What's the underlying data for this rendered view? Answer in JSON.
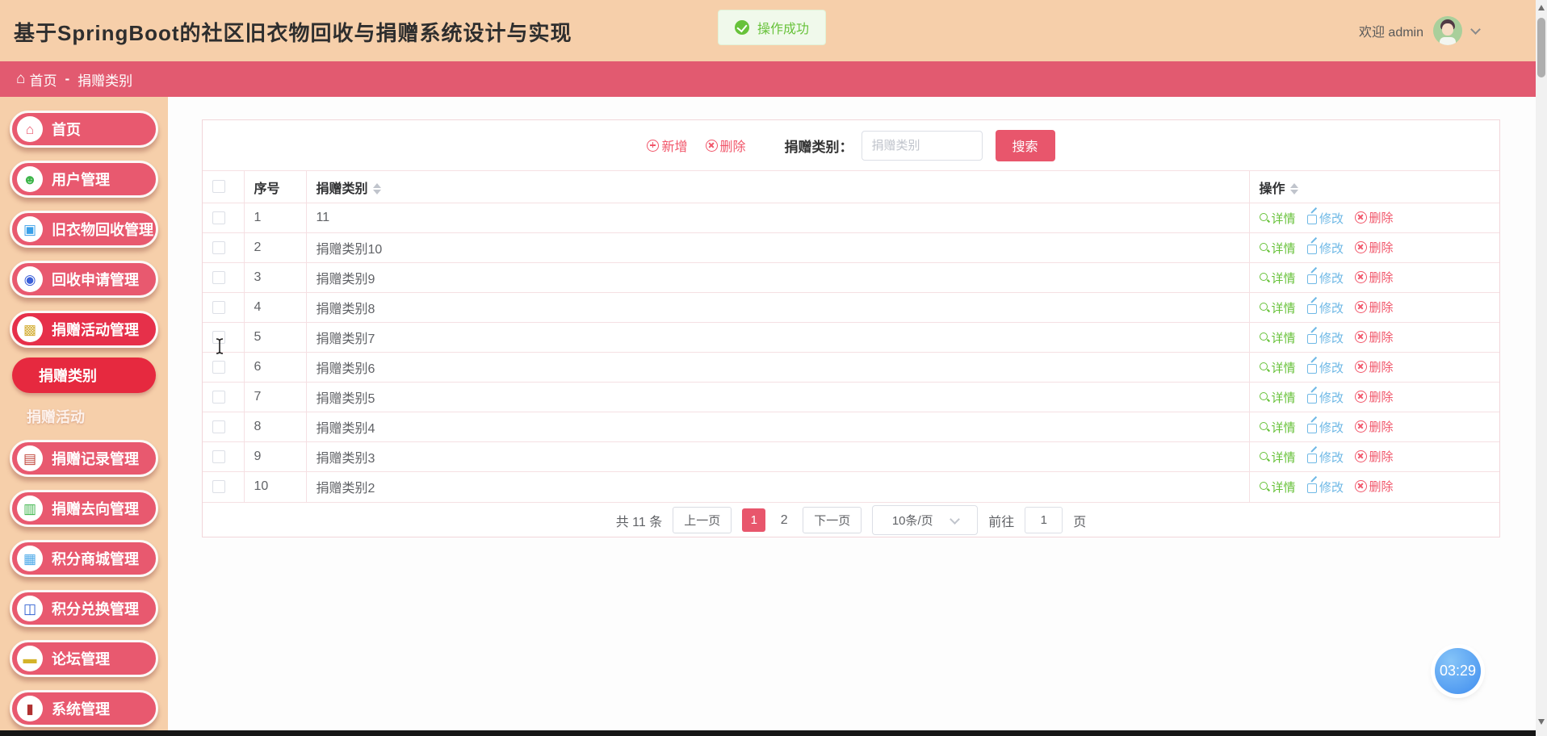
{
  "header": {
    "title": "基于SpringBoot的社区旧衣物回收与捐赠系统设计与实现",
    "toast": "操作成功",
    "welcome": "欢迎 admin"
  },
  "breadcrumb": {
    "home_icon": "⌂",
    "home": "首页",
    "separator": "-",
    "current": "捐赠类别"
  },
  "colors": {
    "peach": "#f6cfaa",
    "breadcrumb_red": "#e25a70",
    "pill_red": "#e8596f",
    "pill_active_red": "#e6304a",
    "accent_red": "#e8566c",
    "success_green": "#67c23a",
    "edit_blue": "#6fb9e6",
    "clock_blue": "#3f8def"
  },
  "sidebar": {
    "items": [
      {
        "label": "首页",
        "icon": "home-icon",
        "glyph": "⌂",
        "icon_color": "#e8566c"
      },
      {
        "label": "用户管理",
        "icon": "user-icon",
        "glyph": "☻",
        "icon_color": "#3cb54a"
      },
      {
        "label": "旧衣物回收管理",
        "icon": "chip-icon",
        "glyph": "▣",
        "icon_color": "#3aa0e8"
      },
      {
        "label": "回收申请管理",
        "icon": "circle-dots-icon",
        "glyph": "◉",
        "icon_color": "#3a5fd8"
      },
      {
        "label": "捐赠活动管理",
        "icon": "donation-box-icon",
        "glyph": "▩",
        "icon_color": "#d4af37"
      },
      {
        "label": "捐赠记录管理",
        "icon": "ledger-icon",
        "glyph": "▤",
        "icon_color": "#c0443a"
      },
      {
        "label": "捐赠去向管理",
        "icon": "book-icon",
        "glyph": "▥",
        "icon_color": "#3cb54a"
      },
      {
        "label": "积分商城管理",
        "icon": "grid-icon",
        "glyph": "▦",
        "icon_color": "#4aa8e8"
      },
      {
        "label": "积分兑换管理",
        "icon": "columns-icon",
        "glyph": "◫",
        "icon_color": "#2f5fd0"
      },
      {
        "label": "论坛管理",
        "icon": "ticket-icon",
        "glyph": "▬",
        "icon_color": "#d4b32a"
      },
      {
        "label": "系统管理",
        "icon": "device-icon",
        "glyph": "▮",
        "icon_color": "#b03030"
      }
    ],
    "submenu": [
      {
        "label": "捐赠类别",
        "active": true
      },
      {
        "label": "捐赠活动",
        "active": false
      }
    ]
  },
  "toolbar": {
    "add_label": "新增",
    "delete_label": "删除",
    "search_label": "捐赠类别：",
    "search_placeholder": "捐赠类别",
    "search_button": "搜索"
  },
  "table": {
    "headers": {
      "index": "序号",
      "category": "捐赠类别",
      "actions": "操作"
    },
    "action_labels": {
      "detail": "详情",
      "edit": "修改",
      "remove": "删除"
    },
    "rows": [
      {
        "no": "1",
        "category": "11"
      },
      {
        "no": "2",
        "category": "捐赠类别10"
      },
      {
        "no": "3",
        "category": "捐赠类别9"
      },
      {
        "no": "4",
        "category": "捐赠类别8"
      },
      {
        "no": "5",
        "category": "捐赠类别7"
      },
      {
        "no": "6",
        "category": "捐赠类别6"
      },
      {
        "no": "7",
        "category": "捐赠类别5"
      },
      {
        "no": "8",
        "category": "捐赠类别4"
      },
      {
        "no": "9",
        "category": "捐赠类别3"
      },
      {
        "no": "10",
        "category": "捐赠类别2"
      }
    ]
  },
  "pagination": {
    "total": "共 11 条",
    "prev": "上一页",
    "page1": "1",
    "page2": "2",
    "next": "下一页",
    "page_size": "10条/页",
    "goto_label": "前往",
    "goto_value": "1",
    "page_unit": "页"
  },
  "clock": {
    "time": "03:29"
  }
}
